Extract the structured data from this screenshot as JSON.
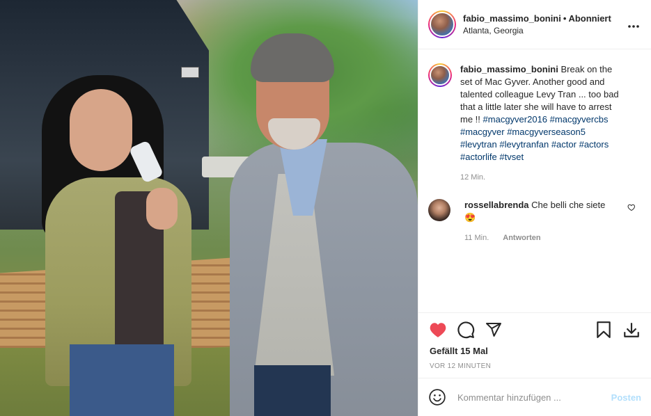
{
  "photo": {
    "description_alt": ""
  },
  "header": {
    "username": "fabio_massimo_bonini",
    "separator": "•",
    "follow_status": "Abonniert",
    "location": "Atlanta, Georgia",
    "more_icon": "more-horizontal-icon"
  },
  "caption": {
    "username": "fabio_massimo_bonini",
    "text": "Break on the set of Mac Gyver. Another good and talented colleague Levy Tran ... too bad that a little later she will have to arrest me !!",
    "hashtags": [
      "#macgyver2016",
      "#macgyvercbs",
      "#macgyver",
      "#macgyverseason5",
      "#levytran",
      "#levytranfan",
      "#actor",
      "#actors",
      "#actorlife",
      "#tvset"
    ],
    "time": "12 Min."
  },
  "comment": {
    "username": "rossellabrenda",
    "text": "Che belli che siete",
    "emoji": "😍",
    "time": "11 Min.",
    "reply_label": "Antworten"
  },
  "actions": {
    "like_icon": "heart-filled-icon",
    "comment_icon": "comment-icon",
    "share_icon": "share-icon",
    "save_icon": "bookmark-icon",
    "download_icon": "download-icon",
    "like_color": "#ed4956"
  },
  "likes_text": "Gefällt 15 Mal",
  "timestamp": "VOR 12 MINUTEN",
  "add_comment": {
    "placeholder": "Kommentar hinzufügen ...",
    "post_label": "Posten",
    "post_color": "#b2dffc"
  }
}
